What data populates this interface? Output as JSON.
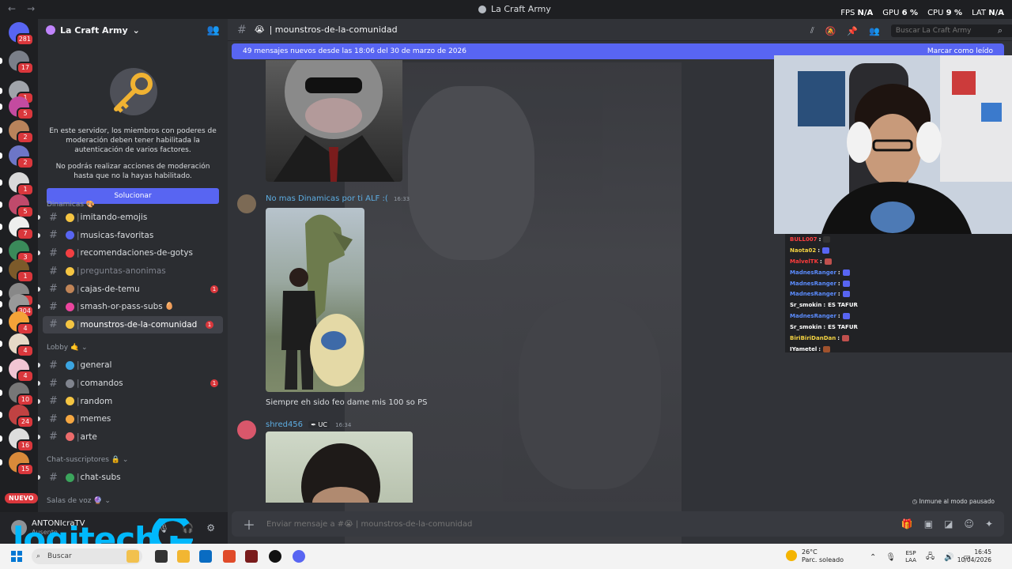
{
  "window": {
    "title": "La Craft Army",
    "stats": {
      "fps_label": "FPS",
      "fps_value": "N/A",
      "gpu_label": "GPU",
      "gpu_value": "6 %",
      "cpu_label": "CPU",
      "cpu_value": "9 %",
      "lat_label": "LAT",
      "lat_value": "N/A"
    }
  },
  "rail": {
    "badges": [
      "281",
      "17",
      "1",
      "5",
      "2",
      "2",
      "1",
      "5",
      "7",
      "3",
      "1",
      "1",
      "304",
      "4",
      "4",
      "4",
      "10",
      "24",
      "16",
      "15"
    ],
    "nuevo_label": "NUEVO"
  },
  "server": {
    "name": "La Craft Army",
    "notice_p1": "En este servidor, los miembros con poderes de moderación deben tener habilitada la autenticación de varios factores.",
    "notice_p2": "No podrás realizar acciones de moderación hasta que no la hayas habilitado.",
    "fix_button": "Solucionar"
  },
  "channels": {
    "top_category": "Dinamicas 🎨",
    "items_a": [
      {
        "name": "imitando-emojis",
        "color": "#f5c542"
      },
      {
        "name": "musicas-favoritas",
        "color": "#5865f2"
      },
      {
        "name": "recomendaciones-de-gotys",
        "color": "#f23f42"
      },
      {
        "name": "preguntas-anonimas",
        "color": "#f5c542",
        "muted": true
      },
      {
        "name": "cajas-de-temu",
        "color": "#c08457",
        "badge": "1"
      },
      {
        "name": "smash-or-pass-subs",
        "color": "#eb459e",
        "suffix": "🥚"
      },
      {
        "name": "mounstros-de-la-comunidad",
        "color": "#f5c542",
        "badge": "1",
        "active": true
      }
    ],
    "lobby_category": "Lobby 🤙",
    "items_b": [
      {
        "name": "general",
        "color": "#3ba4e0"
      },
      {
        "name": "comandos",
        "color": "#80848e",
        "badge": "1"
      },
      {
        "name": "random",
        "color": "#f5c542"
      },
      {
        "name": "memes",
        "color": "#f5a742"
      },
      {
        "name": "arte",
        "color": "#eb6b6b"
      }
    ],
    "subs_category": "Chat-suscriptores 🔒",
    "items_c": [
      {
        "name": "chat-subs",
        "color": "#3ba55c"
      }
    ],
    "voice_category": "Salas de voz 🔮"
  },
  "user": {
    "name": "ANTONIcraTV",
    "status": "Ausente"
  },
  "main": {
    "channel_name": "mounstros-de-la-comunidad",
    "search_placeholder": "Buscar La Craft Army",
    "new_messages": "49 mensajes nuevos desde las 18:06 del 30 de marzo de 2026",
    "mark_read": "Marcar como leído",
    "messages": [
      {
        "author": "No mas Dinamicas por ti ALF :(",
        "time": "16:33",
        "text": "Siempre eh sido feo dame mis 100 so PS"
      },
      {
        "author": "shred456",
        "tag": "UC",
        "time": "16:34"
      }
    ],
    "immune_text": "Inmune al modo pausado",
    "composer_placeholder": "Enviar mensaje a #😭 | mounstros-de-la-comunidad"
  },
  "stream_chat": [
    {
      "user": "BULL007",
      "color": "#ff4040",
      "msg": "",
      "emote": "#333"
    },
    {
      "user": "Naota02",
      "color": "#f5d442",
      "msg": "",
      "emote": "#5865f2"
    },
    {
      "user": "MalvelTK",
      "color": "#ff3b3b",
      "msg": "",
      "emote": "#c0504d"
    },
    {
      "user": "MadnesRanger",
      "color": "#5b8cff",
      "msg": "",
      "emote": "#5865f2"
    },
    {
      "user": "MadnesRanger",
      "color": "#5b8cff",
      "msg": "",
      "emote": "#5865f2"
    },
    {
      "user": "MadnesRanger",
      "color": "#5b8cff",
      "msg": "",
      "emote": "#5865f2"
    },
    {
      "user": "Sr_smokin",
      "color": "#ffffff",
      "msg": "ES TAFUR"
    },
    {
      "user": "MadnesRanger",
      "color": "#5b8cff",
      "msg": "",
      "emote": "#5865f2"
    },
    {
      "user": "Sr_smokin",
      "color": "#ffffff",
      "msg": "ES TAFUR"
    },
    {
      "user": "BiriBiriDanDan",
      "color": "#f5d442",
      "msg": "",
      "emote": "#c0504d"
    },
    {
      "user": "IYametel",
      "color": "#ffffff",
      "msg": "",
      "emote": "#a0522d"
    }
  ],
  "watermark": "logitech",
  "taskbar": {
    "search": "Buscar",
    "weather_temp": "26°C",
    "weather_desc": "Parc. soleado",
    "lang_1": "ESP",
    "lang_2": "LAA",
    "time": "16:45",
    "date": "10/04/2026"
  },
  "colors": {
    "accent": "#5865f2",
    "badge": "#da373c",
    "logitech": "#00b8fc"
  }
}
